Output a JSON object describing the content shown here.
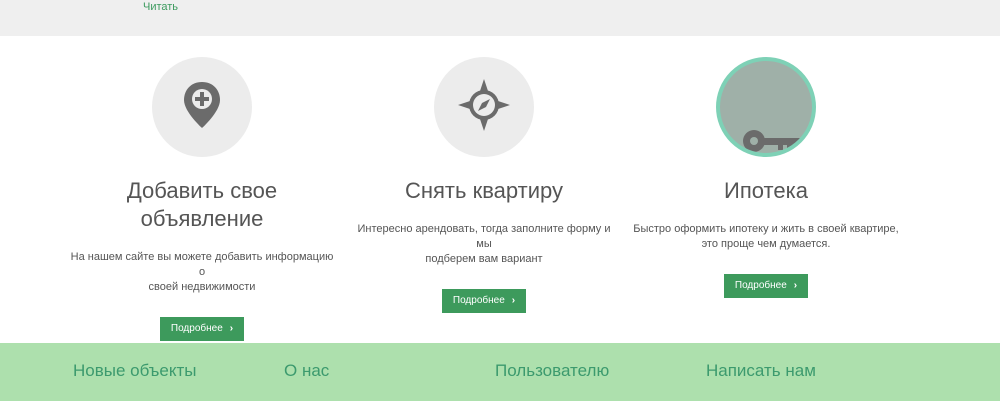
{
  "top": {
    "read_link": "Читать"
  },
  "features": [
    {
      "icon": "map-pin-plus-icon",
      "title_line1": "Добавить свое",
      "title_line2": "объявление",
      "desc_line1": "На нашем сайте вы можете добавить информацию о",
      "desc_line2": "своей недвижимости",
      "button": "Подробнее"
    },
    {
      "icon": "compass-icon",
      "title_line1": "Снять квартиру",
      "desc_line1": "Интересно арендовать, тогда заполните форму и мы",
      "desc_line2": "подберем вам вариант",
      "button": "Подробнее"
    },
    {
      "icon": "key-icon",
      "title_line1": "Ипотека",
      "desc_line1": "Быстро оформить ипотеку и жить в своей квартире,",
      "desc_line2": "это проще чем думается.",
      "button": "Подробнее"
    }
  ],
  "footer": {
    "items": [
      "Новые объекты",
      "О нас",
      "Пользователю",
      "Написать нам"
    ]
  },
  "colors": {
    "accent": "#3d9a5c",
    "footer_bg": "#ade0ad",
    "footer_text": "#3c9a6e",
    "ring": "#7ed1b6"
  }
}
